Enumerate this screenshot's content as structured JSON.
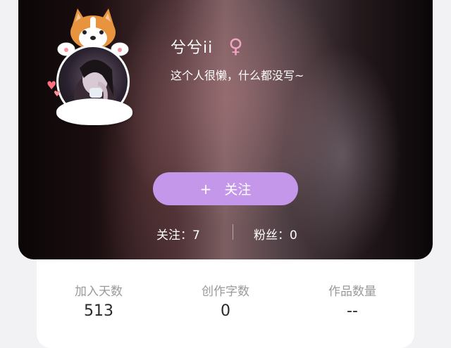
{
  "profile": {
    "username": "兮兮ii",
    "gender_icon": "female-symbol-icon",
    "gender_symbol": "♀",
    "bio": "这个人很懒，什么都没写~",
    "follow_button": {
      "icon": "plus-icon",
      "plus": "+",
      "label": "关注"
    },
    "following": "关注：7",
    "followers": "粉丝：0",
    "colors": {
      "follow_button": "#c497ea",
      "gender": "#f3a4c4"
    }
  },
  "stats": [
    {
      "label": "加入天数",
      "value": "513"
    },
    {
      "label": "创作字数",
      "value": "0"
    },
    {
      "label": "作品数量",
      "value": "--"
    }
  ]
}
